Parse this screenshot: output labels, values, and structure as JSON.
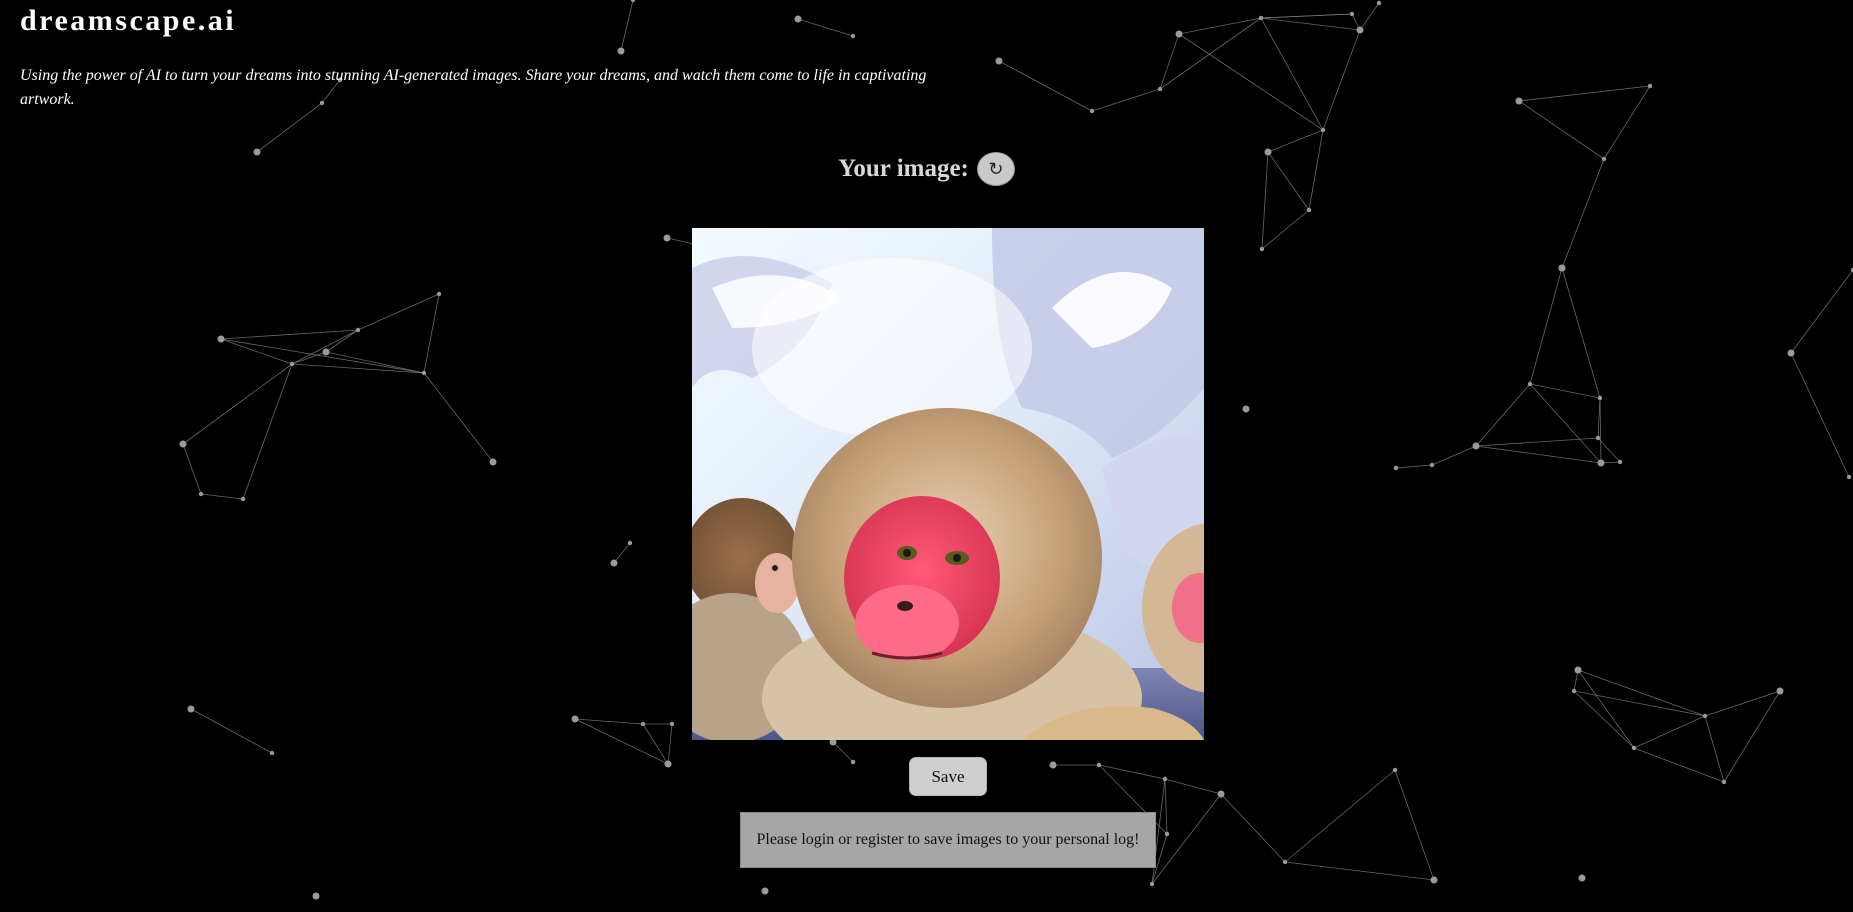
{
  "header": {
    "brand": "dreamscape.ai",
    "tagline": "Using the power of AI to turn your dreams into stunning AI-generated images. Share your dreams, and watch them come to life in captivating artwork."
  },
  "result": {
    "heading": "Your image:",
    "regenerate_icon": "↻",
    "image_description_icon": "generated-image",
    "save_label": "Save",
    "login_notice": "Please login or register to save images to your personal log!"
  },
  "colors": {
    "background": "#000000",
    "network_line": "#8a8a8a",
    "network_node": "#9a9a9a",
    "button": "#cfcfcf",
    "notice": "#a6a6a6"
  }
}
